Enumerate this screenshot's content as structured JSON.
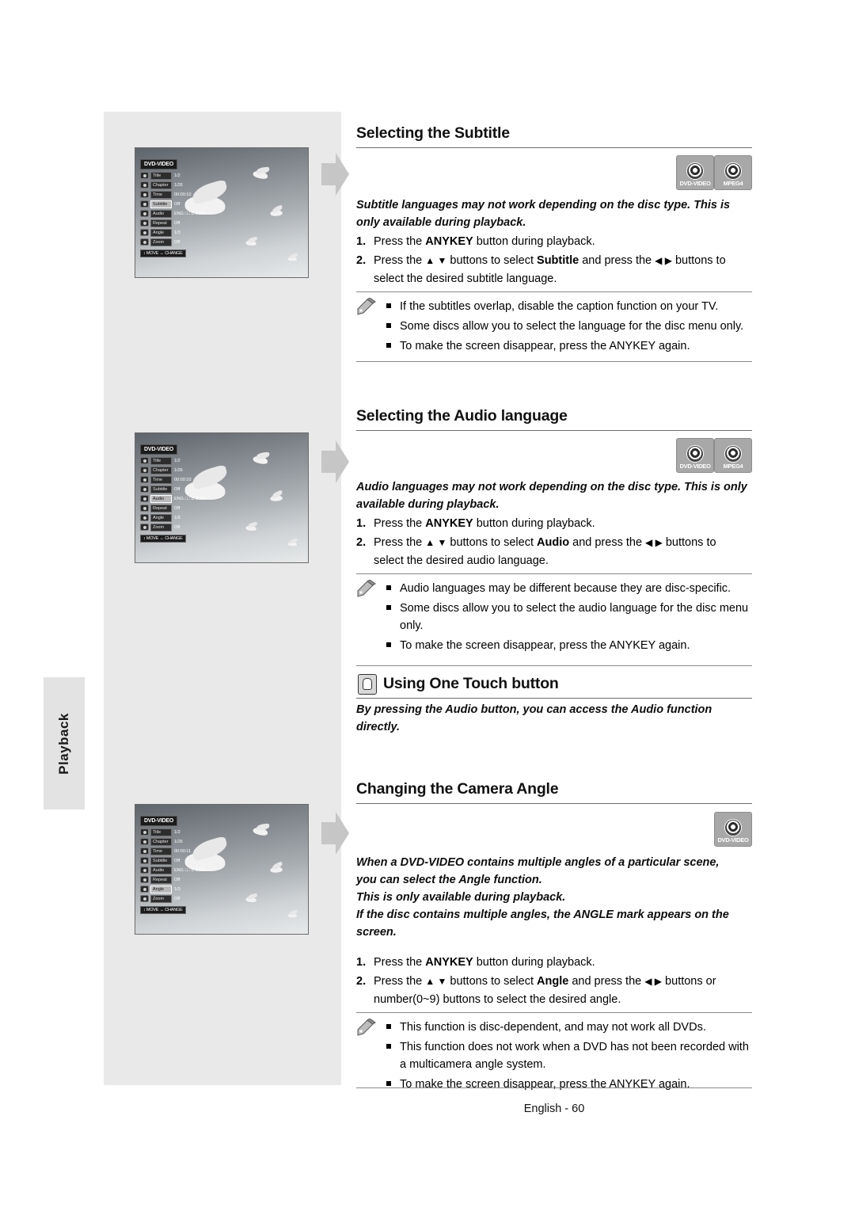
{
  "sidebar": {
    "tab_label": "Playback"
  },
  "footer": {
    "text": "English - 60"
  },
  "sections": [
    {
      "title": "Selecting the Subtitle",
      "intro": "Subtitle languages may not work depending on the disc type. This is only available during playback.",
      "steps": [
        {
          "num": "1.",
          "pre": "Press the ",
          "bold": "ANYKEY",
          "post": " button during playback."
        },
        {
          "num": "2.",
          "line1_a": "Press the ",
          "line1_tri": "▲ ▼",
          "line1_b": " buttons to select ",
          "line1_bold": "Subtitle",
          "line1_c": " and press the ",
          "line1_tri2": "◀ ▶",
          "line1_d": " buttons to",
          "line2": "select the desired subtitle language."
        }
      ],
      "notes": [
        "If the subtitles overlap, disable the caption function on your TV.",
        "Some discs allow you to select the language for the disc menu only.",
        "To make the screen disappear, press the ANYKEY again."
      ],
      "badges": [
        "DVD-VIDEO",
        "MPEG4"
      ]
    },
    {
      "title": "Selecting the Audio language",
      "intro": "Audio languages may not work depending on the disc type. This is only available during playback.",
      "steps": [
        {
          "num": "1.",
          "pre": "Press the ",
          "bold": "ANYKEY",
          "post": " button during playback."
        },
        {
          "num": "2.",
          "line1_a": "Press the ",
          "line1_tri": "▲ ▼",
          "line1_b": " buttons to select ",
          "line1_bold": "Audio",
          "line1_c": " and press the ",
          "line1_tri2": "◀ ▶",
          "line1_d": " buttons to",
          "line2": "select the desired audio language."
        }
      ],
      "notes": [
        "Audio languages may be different because they are disc-specific.",
        "Some discs allow you to select the audio language for the disc menu only.",
        "To make the screen disappear, press the ANYKEY again."
      ],
      "badges": [
        "DVD-VIDEO",
        "MPEG4"
      ]
    },
    {
      "title": "Using One Touch button",
      "intro": "By pressing the Audio button, you can access the Audio function directly.",
      "icon": "one-touch-icon"
    },
    {
      "title": "Changing the Camera Angle",
      "intro_lines": [
        "When a DVD-VIDEO contains multiple angles of a particular scene,",
        "you can select the Angle function.",
        "This is only available during playback.",
        "If the disc contains multiple angles, the ANGLE mark appears on the",
        "screen."
      ],
      "steps": [
        {
          "num": "1.",
          "pre": "Press the ",
          "bold": "ANYKEY",
          "post": " button during playback."
        },
        {
          "num": "2.",
          "line1_a": "Press the ",
          "line1_tri": "▲ ▼",
          "line1_b": " buttons to select ",
          "line1_bold": "Angle",
          "line1_c": " and press the ",
          "line1_tri2": "◀ ▶",
          "line1_d": " buttons or",
          "line2": "number(0~9) buttons to select the desired angle."
        }
      ],
      "notes": [
        "This function is disc-dependent, and may not work all DVDs.",
        "This function does not work when a DVD has not been recorded with a multicamera angle system.",
        "To make the screen disappear, press the ANYKEY again."
      ],
      "badges": [
        "DVD-VIDEO"
      ]
    }
  ],
  "osd_screens": [
    {
      "header": "DVD-VIDEO",
      "selected": "Subtitle",
      "rows": [
        {
          "name": "Title",
          "value": "1/2"
        },
        {
          "name": "Chapter",
          "value": "1/26"
        },
        {
          "name": "Time",
          "value": "00:00:10"
        },
        {
          "name": "Subtitle",
          "value": "Off"
        },
        {
          "name": "Audio",
          "value": "ENG □□ D 2CH"
        },
        {
          "name": "Repeat",
          "value": "Off"
        },
        {
          "name": "Angle",
          "value": "1/3"
        },
        {
          "name": "Zoom",
          "value": "Off"
        }
      ],
      "footer": "↕ MOVE   ↔ CHANGE"
    },
    {
      "header": "DVD-VIDEO",
      "selected": "Audio",
      "rows": [
        {
          "name": "Title",
          "value": "1/2"
        },
        {
          "name": "Chapter",
          "value": "1/26"
        },
        {
          "name": "Time",
          "value": "00:00:10"
        },
        {
          "name": "Subtitle",
          "value": "Off"
        },
        {
          "name": "Audio",
          "value": "ENG □□ D 2CH"
        },
        {
          "name": "Repeat",
          "value": "Off"
        },
        {
          "name": "Angle",
          "value": "1/3"
        },
        {
          "name": "Zoom",
          "value": "Off"
        }
      ],
      "footer": "↕ MOVE   ↔ CHANGE"
    },
    {
      "header": "DVD-VIDEO",
      "selected": "Angle",
      "rows": [
        {
          "name": "Title",
          "value": "1/2"
        },
        {
          "name": "Chapter",
          "value": "1/26"
        },
        {
          "name": "Time",
          "value": "00:00:11"
        },
        {
          "name": "Subtitle",
          "value": "Off"
        },
        {
          "name": "Audio",
          "value": "ENG □□ D 2CH"
        },
        {
          "name": "Repeat",
          "value": "Off"
        },
        {
          "name": "Angle",
          "value": "1/3"
        },
        {
          "name": "Zoom",
          "value": "Off"
        }
      ],
      "footer": "↕ MOVE   ↔ CHANGE"
    }
  ]
}
